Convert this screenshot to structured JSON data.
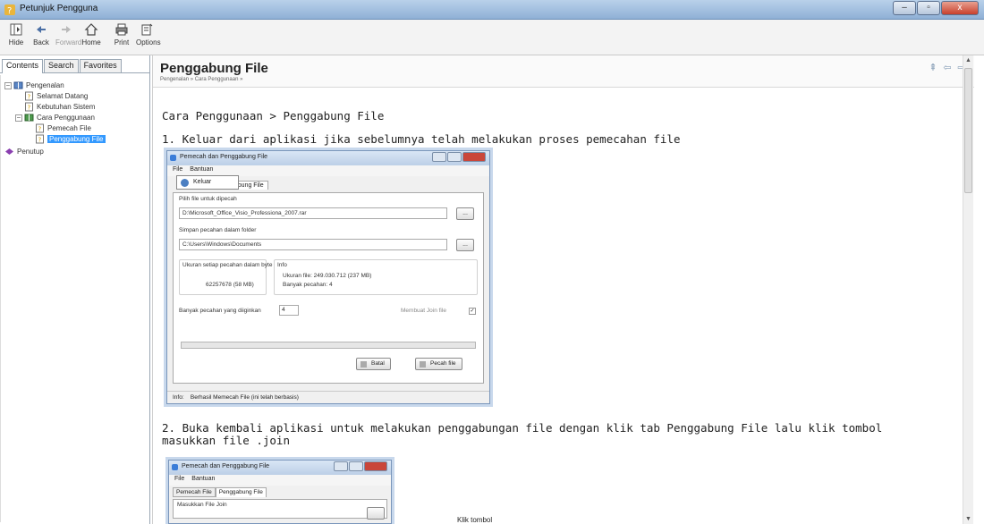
{
  "window": {
    "title": "Petunjuk Pengguna"
  },
  "window_buttons": [
    "–",
    "▫",
    "x"
  ],
  "toolbar": {
    "hide": "Hide",
    "back": "Back",
    "forward": "Forward",
    "home": "Home",
    "print": "Print",
    "options": "Options"
  },
  "nav": {
    "tabs": [
      "Contents",
      "Search",
      "Favorites"
    ],
    "tree": [
      {
        "label": "Pengenalan",
        "expander": "–"
      },
      {
        "label": "Selamat Datang"
      },
      {
        "label": "Kebutuhan Sistem"
      },
      {
        "label": "Cara Penggunaan",
        "expander": "–"
      },
      {
        "label": "Pemecah File"
      },
      {
        "label": "Penggabung File"
      },
      {
        "label": "Penutup"
      }
    ]
  },
  "content": {
    "title": "Penggabung File",
    "breadcrumb": "Pengenalan » Cara Penggunaan »",
    "heading": "Cara Penggunaan > Penggabung File",
    "step1": "1. Keluar dari aplikasi jika sebelumnya telah melakukan proses pemecahan file",
    "step2_line1": "2. Buka kembali aplikasi untuk melakukan penggabungan file dengan klik tab Penggabung File lalu klik tombol",
    "step2_line2": "masukkan file .join",
    "klik": "Klik tombol"
  },
  "nav_arrows": [
    "⇞",
    "⇦",
    "⇨"
  ],
  "scroll_arrows": {
    "up": "▲",
    "down": "▼"
  },
  "dialog1": {
    "title": "Pemecah dan Penggabung File",
    "menu": [
      "File",
      "Bantuan"
    ],
    "menu_item": "Keluar",
    "tab_partial": "gabung File",
    "label_pilih": "Pilih file untuk dipecah",
    "file_path": "D:\\Microsoft_Office_Visio_Professiona_2007.rar",
    "label_simpan": "Simpan pecahan dalam folder",
    "folder_path": "C:\\Users\\Windows\\Documents",
    "browse": "...",
    "label_ukuran": "Ukuran setiap pecahan dalam byte",
    "ukuran_value": "62257678   (58 MB)",
    "label_info": "Info",
    "info_size": "Ukuran file: 249.030.712 (237 MB)",
    "info_count": "Banyak pecahan: 4",
    "label_banyak": "Banyak pecahan yang diiginkan",
    "banyak_value": "4",
    "membuat_join": "Membuat Join file",
    "check": "✓",
    "batal": "Batal",
    "pecah": "Pecah file",
    "status_label": "Info:",
    "status_text": "Berhasil Memecah File (ini telah berbasis)"
  },
  "dialog2": {
    "title": "Pemecah dan Penggabung File",
    "menu": [
      "File",
      "Bantuan"
    ],
    "tabs": [
      "Pemecah File",
      "Penggabung File"
    ],
    "label": "Masukkan File Join"
  }
}
